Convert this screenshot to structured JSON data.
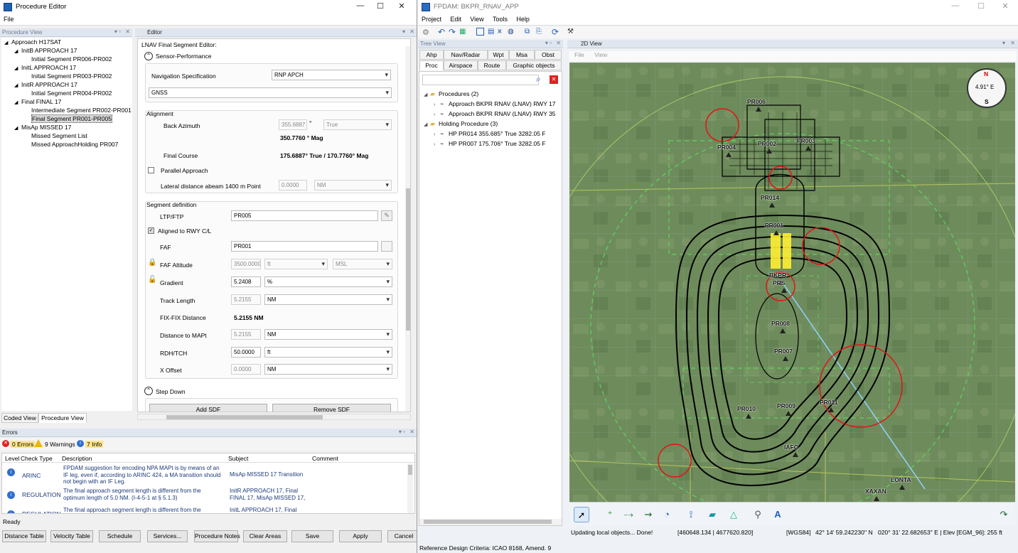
{
  "left_window": {
    "title": "Procedure Editor",
    "menu": [
      "File"
    ],
    "procedure_panel_title": "Procedure View",
    "procedure_tree": [
      {
        "label": "Approach H17SAT",
        "level": 0
      },
      {
        "label": "InitB APPROACH 17",
        "level": 1
      },
      {
        "label": "Initial Segment PR006-PR002",
        "level": 2
      },
      {
        "label": "InitL APPROACH 17",
        "level": 1
      },
      {
        "label": "Initial Segment PR003-PR002",
        "level": 2
      },
      {
        "label": "InitR APPROACH 17",
        "level": 1
      },
      {
        "label": "Initial Segment PR004-PR002",
        "level": 2
      },
      {
        "label": "Final FINAL 17",
        "level": 1
      },
      {
        "label": "Intermediate Segment PR002-PR001",
        "level": 2
      },
      {
        "label": "Final Segment PR001-PR005",
        "level": 2,
        "selected": true
      },
      {
        "label": "MisAp MISSED 17",
        "level": 1
      },
      {
        "label": "Missed Segment List",
        "level": 2
      },
      {
        "label": "Missed ApproachHolding PR007",
        "level": 2
      }
    ],
    "bottom_tabs": [
      "Coded View",
      "Procedure View"
    ],
    "editor_tab": "Editor",
    "editor": {
      "heading": "LNAV Final Segment Editor:",
      "sensor_section": "Sensor-Performance",
      "nav_spec_label": "Navigation Specification",
      "nav_spec_value": "RNP APCH",
      "sensor_value": "GNSS",
      "alignment_title": "Alignment",
      "back_azimuth_label": "Back Azimuth",
      "back_azimuth_value": "355.6887",
      "degree_symbol": "°",
      "back_azimuth_ref": "True",
      "back_azimuth_mag": "350.7760 ° Mag",
      "final_course_label": "Final Course",
      "final_course_value": "175.6887° True / 170.7760° Mag",
      "parallel_label": "Parallel Approach",
      "lateral_label": "Lateral distance abeam 1400 m Point",
      "lateral_value": "0.0000",
      "lateral_unit": "NM",
      "segdef_title": "Segment definition",
      "ltp_label": "LTP/FTP",
      "ltp_value": "PR005",
      "aligned_label": "Aligned to RWY C/L",
      "faf_label": "FAF",
      "faf_value": "PR001",
      "faf_alt_label": "FAF Altitude",
      "faf_alt_value": "3500.0000",
      "faf_alt_unit": "ft",
      "faf_alt_ref": "MSL",
      "gradient_label": "Gradient",
      "gradient_value": "5.2408",
      "gradient_unit": "%",
      "track_label": "Track Length",
      "track_value": "5.2155",
      "track_unit": "NM",
      "fixfix_label": "FIX-FIX Distance",
      "fixfix_value": "5.2155 NM",
      "dmapt_label": "Distance to MAPt",
      "dmapt_value": "5.2155",
      "dmapt_unit": "NM",
      "rdh_label": "RDH/TCH",
      "rdh_value": "50.0000",
      "rdh_unit": "ft",
      "xoff_label": "X Offset",
      "xoff_value": "0.0000",
      "xoff_unit": "NM",
      "stepdown_title": "Step Down",
      "add_sdf": "Add SDF",
      "remove_sdf": "Remove SDF"
    },
    "errors": {
      "title": "Errors",
      "filter_errors": "0 Errors",
      "filter_warnings": "9 Warnings",
      "filter_info": "7 Info",
      "columns": [
        "Level",
        "Check Type",
        "Description",
        "Subject",
        "Comment"
      ],
      "rows": [
        {
          "check": "ARINC",
          "description": "FPDAM suggestion for encoding NPA MAPt is by means of an IF leg, even if, according to ARINC 424, a MA transition should not begin with an IF Leg.",
          "subject": "MisAp MISSED 17 Transition"
        },
        {
          "check": "REGULATION",
          "description": "The final approach segment length is different from the optimum length of 5.0 NM. (I-4-5-1 at § 5.1.3)",
          "subject": "InitR APPROACH 17, Final FINAL 17, MisAp MISSED 17,"
        },
        {
          "check": "REGULATION",
          "description": "The final approach segment length is different from the",
          "subject": "InitL APPROACH 17, Final"
        }
      ]
    },
    "status": "Ready",
    "buttons": [
      "Distance Table",
      "Velocity Table",
      "Schedule",
      "Services...",
      "Procedure Notes",
      "Clear Areas",
      "Save",
      "Apply",
      "Cancel"
    ]
  },
  "right_window": {
    "title": "FPDAM: BKPR_RNAV_APP",
    "menu": [
      "Project",
      "Edit",
      "View",
      "Tools",
      "Help"
    ],
    "tree_panel_title": "Tree View",
    "tabs_row1": [
      "Ahp",
      "Nav/Radar",
      "Wpt",
      "Msa",
      "Obst"
    ],
    "tabs_row2": [
      "Proc",
      "Airspace",
      "Route",
      "Graphic objects"
    ],
    "tree": [
      {
        "label": "Procedures (2)",
        "level": 0
      },
      {
        "label": "Approach BKPR RNAV (LNAV) RWY 17",
        "level": 1
      },
      {
        "label": "Approach BKPR RNAV (LNAV) RWY 35",
        "level": 1
      },
      {
        "label": "Holding Procedure (3)",
        "level": 0
      },
      {
        "label": "HP PR014 355.685° True 3282.05 F",
        "level": 1
      },
      {
        "label": "HP PR007 175.706° True 3282.05 F",
        "level": 1
      }
    ],
    "map_tab": "2D View",
    "map_menu": [
      "File",
      "View"
    ],
    "compass": "4.91° E",
    "compass_n": "N",
    "compass_s": "S",
    "waypoints": [
      "PR006",
      "PR004",
      "PR002",
      "PR003",
      "PR014",
      "PR001",
      "BKPR",
      "PRS",
      "PR008",
      "PR007",
      "PR010",
      "PR009",
      "PR011",
      "IAFC",
      "LONTA",
      "XAXAN"
    ],
    "status_msg": "Updating local objects... Done!",
    "status_coords": "[460648.134 | 4677620.820]",
    "status_datum": "[WGS84]",
    "status_lat": "42° 14' 59.242230'' N",
    "status_lon": "020° 31' 22.682653'' E | Elev [EGM_96]: 255 ft",
    "footer": "Reference Design Criteria: ICAO 8168, Amend. 9"
  }
}
